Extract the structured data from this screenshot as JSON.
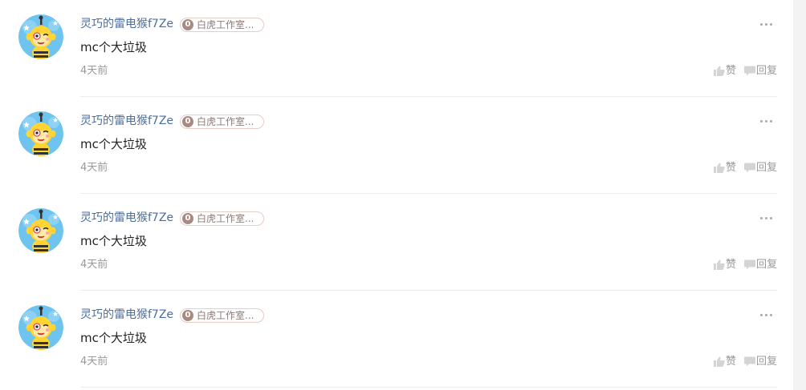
{
  "comments": [
    {
      "username": "灵巧的雷电猴f7Ze",
      "badge_level": "0",
      "badge_text": "白虎工作室...",
      "content": "mc个大垃圾",
      "time": "4天前",
      "like_label": "赞",
      "reply_label": "回复"
    },
    {
      "username": "灵巧的雷电猴f7Ze",
      "badge_level": "0",
      "badge_text": "白虎工作室...",
      "content": "mc个大垃圾",
      "time": "4天前",
      "like_label": "赞",
      "reply_label": "回复"
    },
    {
      "username": "灵巧的雷电猴f7Ze",
      "badge_level": "0",
      "badge_text": "白虎工作室...",
      "content": "mc个大垃圾",
      "time": "4天前",
      "like_label": "赞",
      "reply_label": "回复"
    },
    {
      "username": "灵巧的雷电猴f7Ze",
      "badge_level": "0",
      "badge_text": "白虎工作室...",
      "content": "mc个大垃圾",
      "time": "4天前",
      "like_label": "赞",
      "reply_label": "回复"
    }
  ],
  "icons": {
    "avatar": "monkey-mascot-avatar",
    "more": "more-dots-icon",
    "like": "thumbs-up-icon",
    "reply": "speech-bubble-icon"
  },
  "colors": {
    "username": "#4d6d9b",
    "badge_level_bg": "#a98a82",
    "muted": "#999999",
    "divider": "#ececec"
  }
}
